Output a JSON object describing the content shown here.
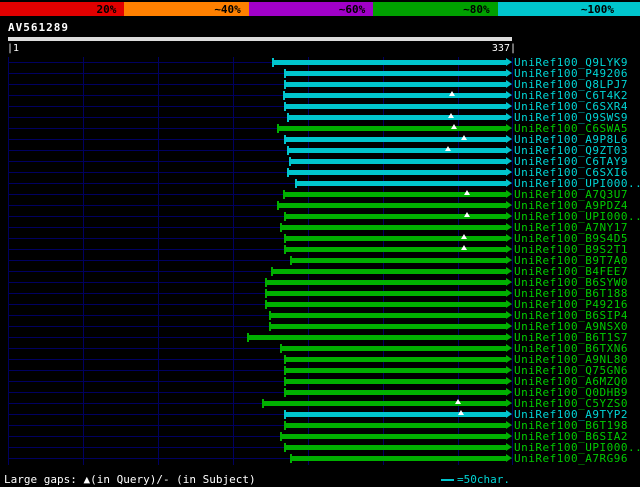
{
  "scale_bar": {
    "segments": [
      {
        "label": "20%",
        "color": "#e10000"
      },
      {
        "label": "~40%",
        "color": "#ff8000"
      },
      {
        "label": "~60%",
        "color": "#a000c8"
      },
      {
        "label": "~80%",
        "color": "#00a000"
      },
      {
        "label": "~100%",
        "color": "#00c5cd"
      }
    ]
  },
  "query": {
    "name": "AV561289",
    "start_label": "|1",
    "end_label": "337|"
  },
  "colors": {
    "cyan": "#00c5cd",
    "green": "#00b000",
    "cyan_label": "#00d5d5",
    "green_label": "#00cc00",
    "grid": "#000060",
    "query_bar": "#dcdcdc"
  },
  "chart_data": {
    "type": "bar",
    "orientation": "horizontal",
    "title": "",
    "x_range": [
      1,
      337
    ],
    "x_start_label": "|1",
    "x_end_label": "337|",
    "legend": "identity color scale: red 20%, orange ~40%, purple ~60%, green ~80%, cyan ~100%",
    "rows": [
      {
        "id": "UniRef100_Q9LYK9",
        "class": "cyan",
        "start": 177,
        "end": 337,
        "gaps": []
      },
      {
        "id": "UniRef100_P49206",
        "class": "cyan",
        "start": 185,
        "end": 337,
        "gaps": []
      },
      {
        "id": "UniRef100_Q8LPJ7",
        "class": "cyan",
        "start": 185,
        "end": 337,
        "gaps": []
      },
      {
        "id": "UniRef100_C6T4K2",
        "class": "cyan",
        "start": 184,
        "end": 337,
        "gaps": [
          295
        ]
      },
      {
        "id": "UniRef100_C6SXR4",
        "class": "cyan",
        "start": 185,
        "end": 337,
        "gaps": []
      },
      {
        "id": "UniRef100_Q9SWS9",
        "class": "cyan",
        "start": 187,
        "end": 337,
        "gaps": [
          294
        ]
      },
      {
        "id": "UniRef100_C6SWA5",
        "class": "green",
        "start": 180,
        "end": 337,
        "gaps": [
          296
        ]
      },
      {
        "id": "UniRef100_A9P8L6",
        "class": "cyan",
        "start": 185,
        "end": 337,
        "gaps": [
          303
        ]
      },
      {
        "id": "UniRef100_Q9ZT03",
        "class": "cyan",
        "start": 187,
        "end": 337,
        "gaps": [
          292
        ]
      },
      {
        "id": "UniRef100_C6TAY9",
        "class": "cyan",
        "start": 188,
        "end": 337,
        "gaps": []
      },
      {
        "id": "UniRef100_C6SXI6",
        "class": "cyan",
        "start": 187,
        "end": 337,
        "gaps": []
      },
      {
        "id": "UniRef100_UPI000...",
        "class": "cyan",
        "start": 192,
        "end": 337,
        "gaps": []
      },
      {
        "id": "UniRef100_A7Q3U7",
        "class": "green",
        "start": 184,
        "end": 337,
        "gaps": [
          305
        ]
      },
      {
        "id": "UniRef100_A9PDZ4",
        "class": "green",
        "start": 180,
        "end": 337,
        "gaps": []
      },
      {
        "id": "UniRef100_UPI000...",
        "class": "green",
        "start": 185,
        "end": 337,
        "gaps": [
          305
        ]
      },
      {
        "id": "UniRef100_A7NY17",
        "class": "green",
        "start": 182,
        "end": 337,
        "gaps": []
      },
      {
        "id": "UniRef100_B9S4D5",
        "class": "green",
        "start": 185,
        "end": 337,
        "gaps": [
          303
        ]
      },
      {
        "id": "UniRef100_B9S2T1",
        "class": "green",
        "start": 185,
        "end": 337,
        "gaps": [
          303
        ]
      },
      {
        "id": "UniRef100_B9T7A0",
        "class": "green",
        "start": 189,
        "end": 337,
        "gaps": []
      },
      {
        "id": "UniRef100_B4FEE7",
        "class": "green",
        "start": 176,
        "end": 337,
        "gaps": []
      },
      {
        "id": "UniRef100_B6SYW0",
        "class": "green",
        "start": 172,
        "end": 337,
        "gaps": []
      },
      {
        "id": "UniRef100_B6T188",
        "class": "green",
        "start": 172,
        "end": 337,
        "gaps": []
      },
      {
        "id": "UniRef100_P49216",
        "class": "green",
        "start": 172,
        "end": 337,
        "gaps": []
      },
      {
        "id": "UniRef100_B6SIP4",
        "class": "green",
        "start": 175,
        "end": 337,
        "gaps": []
      },
      {
        "id": "UniRef100_A9NSX0",
        "class": "green",
        "start": 175,
        "end": 337,
        "gaps": []
      },
      {
        "id": "UniRef100_B6T1S7",
        "class": "green",
        "start": 160,
        "end": 337,
        "gaps": []
      },
      {
        "id": "UniRef100_B6TXN6",
        "class": "green",
        "start": 182,
        "end": 337,
        "gaps": []
      },
      {
        "id": "UniRef100_A9NL80",
        "class": "green",
        "start": 185,
        "end": 337,
        "gaps": []
      },
      {
        "id": "UniRef100_Q75GN6",
        "class": "green",
        "start": 185,
        "end": 337,
        "gaps": []
      },
      {
        "id": "UniRef100_A6MZQ0",
        "class": "green",
        "start": 185,
        "end": 337,
        "gaps": []
      },
      {
        "id": "UniRef100_Q0DHB9",
        "class": "green",
        "start": 185,
        "end": 337,
        "gaps": []
      },
      {
        "id": "UniRef100_C5YZS0",
        "class": "green",
        "start": 170,
        "end": 337,
        "gaps": [
          299
        ]
      },
      {
        "id": "UniRef100_A9TYP2",
        "class": "cyan",
        "start": 185,
        "end": 337,
        "gaps": [
          301
        ]
      },
      {
        "id": "UniRef100_B6T198",
        "class": "green",
        "start": 185,
        "end": 337,
        "gaps": []
      },
      {
        "id": "UniRef100_B6SIA2",
        "class": "green",
        "start": 182,
        "end": 337,
        "gaps": []
      },
      {
        "id": "UniRef100_UPI000...",
        "class": "green",
        "start": 185,
        "end": 337,
        "gaps": []
      },
      {
        "id": "UniRef100_A7RG96",
        "class": "green",
        "start": 189,
        "end": 337,
        "gaps": []
      }
    ]
  },
  "footer": {
    "gaps_legend": "Large gaps: ▲(in Query)/- (in Subject)",
    "scale_legend": "=50char."
  }
}
